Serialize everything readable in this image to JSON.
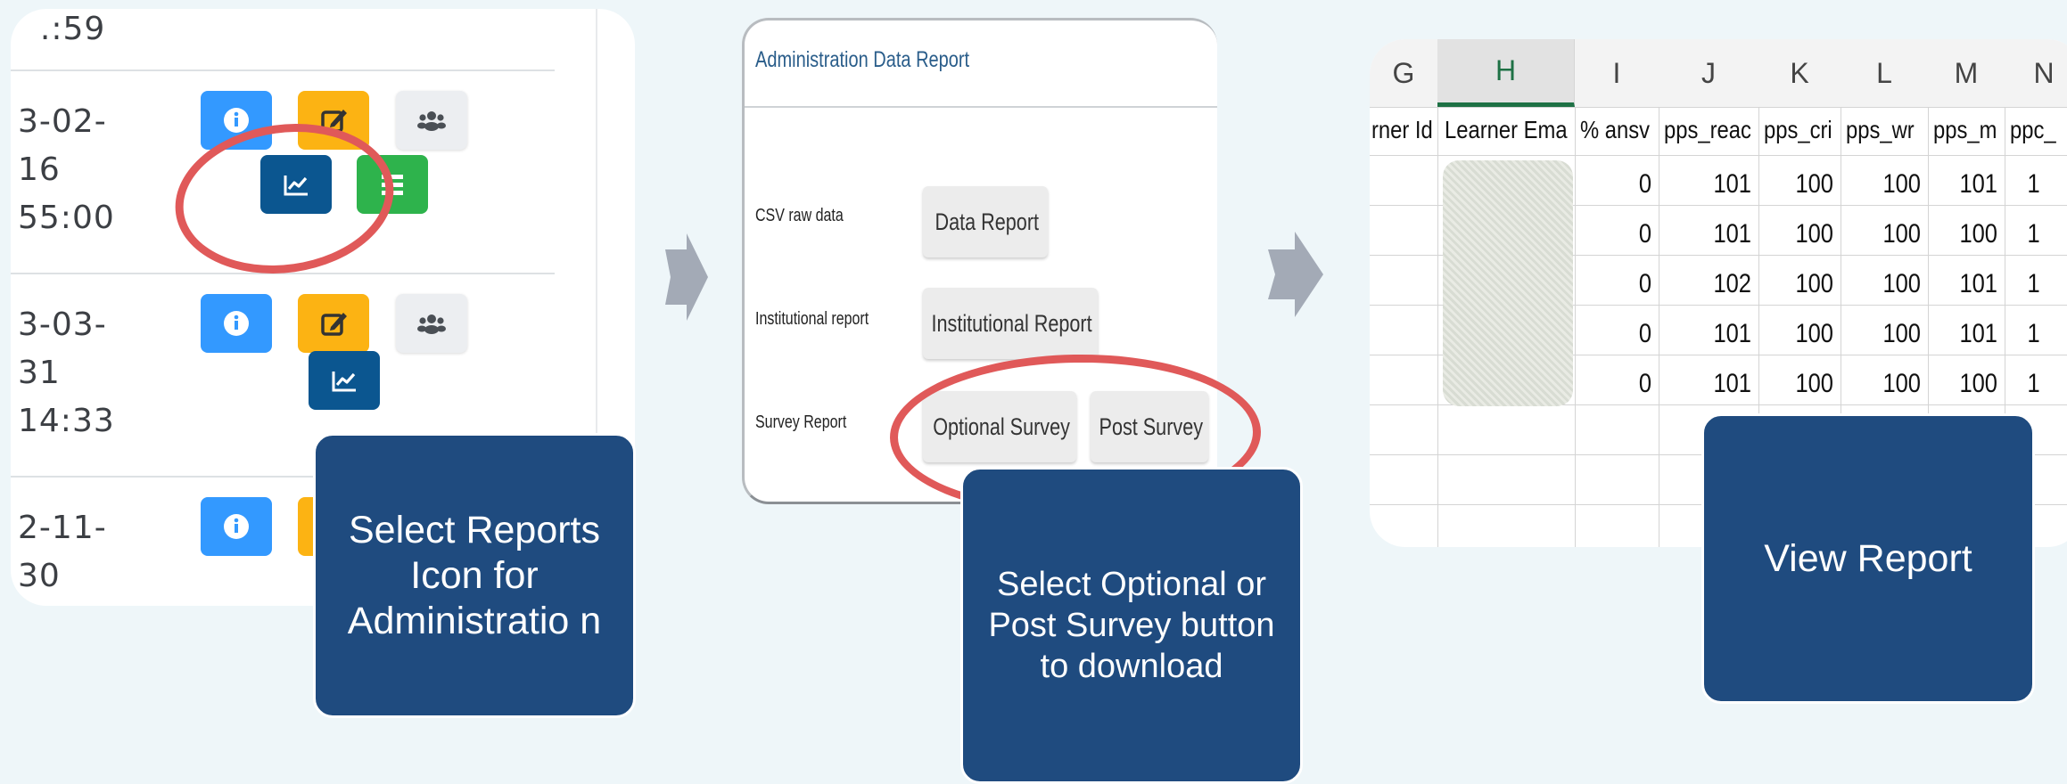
{
  "panel1": {
    "dates": [
      "  .:59",
      "3-02-\n16\n55:00",
      "3-03-\n31\n14:33",
      "2-11-\n30"
    ]
  },
  "panel2": {
    "title": "Administration Data Report",
    "rows": [
      {
        "label": "CSV raw data",
        "button": "Data Report"
      },
      {
        "label": "Institutional report",
        "button": "Institutional Report"
      },
      {
        "label": "Survey Report",
        "buttons": [
          "Optional Survey",
          "Post Survey"
        ]
      }
    ]
  },
  "panel3": {
    "columns": [
      "G",
      "H",
      "I",
      "J",
      "K",
      "L",
      "M",
      "N"
    ],
    "headers": [
      "rner Id",
      "Learner Ema",
      "% ansv",
      "pps_reac",
      "pps_cri",
      "pps_wr",
      "pps_m",
      "ppc_"
    ],
    "rows": [
      [
        "0",
        "101",
        "100",
        "100",
        "101",
        "1"
      ],
      [
        "0",
        "101",
        "100",
        "100",
        "100",
        "1"
      ],
      [
        "0",
        "102",
        "100",
        "100",
        "101",
        "1"
      ],
      [
        "0",
        "101",
        "100",
        "100",
        "101",
        "1"
      ],
      [
        "0",
        "101",
        "100",
        "100",
        "100",
        "1"
      ]
    ]
  },
  "captions": {
    "step1": "Select Reports Icon for Administratio n",
    "step2": "Select Optional or Post Survey button to download",
    "step3": "View Report"
  },
  "colors": {
    "caption_bg": "#1f4b7f",
    "highlight_ring": "#e05959",
    "arrow": "#a3aab6"
  }
}
